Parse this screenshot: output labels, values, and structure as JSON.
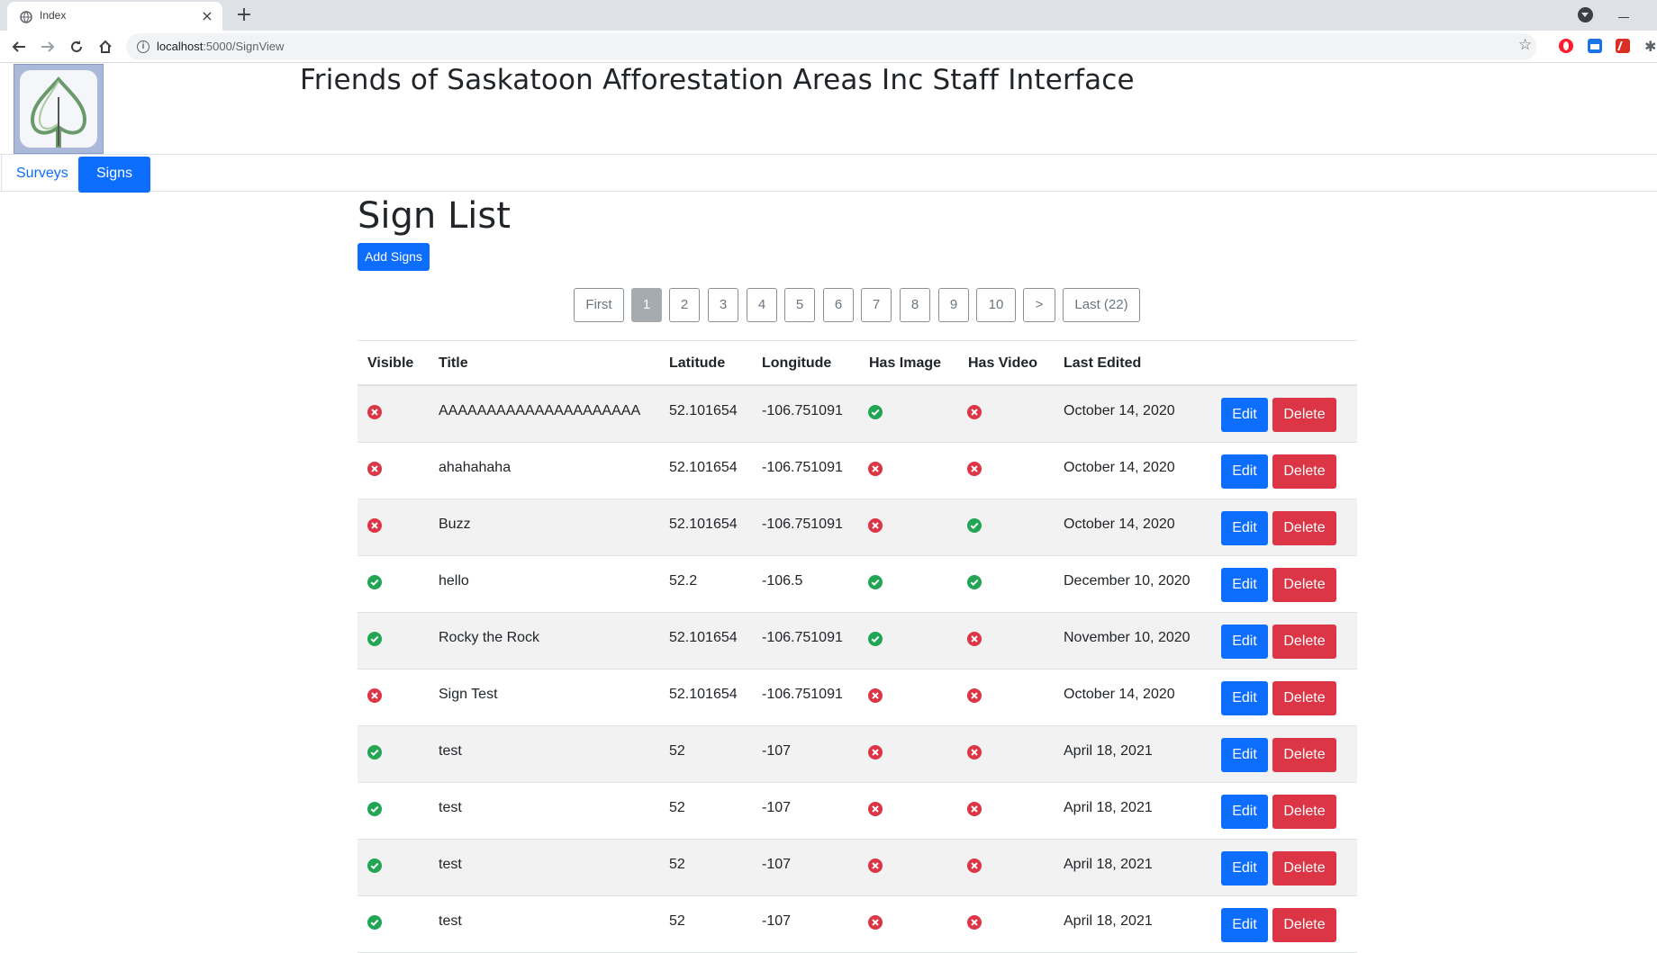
{
  "browser": {
    "tab_title": "Index",
    "url_host": "localhost",
    "url_path": ":5000/SignView"
  },
  "header": {
    "site_title": "Friends of Saskatoon Afforestation Areas Inc Staff Interface"
  },
  "nav": {
    "items": [
      {
        "label": "Surveys",
        "active": false
      },
      {
        "label": "Signs",
        "active": true
      }
    ]
  },
  "main": {
    "title": "Sign List",
    "add_button": "Add Signs",
    "pagination": {
      "items": [
        "First",
        "1",
        "2",
        "3",
        "4",
        "5",
        "6",
        "7",
        "8",
        "9",
        "10",
        ">",
        "Last (22)"
      ],
      "active": "1"
    },
    "table": {
      "columns": [
        "Visible",
        "Title",
        "Latitude",
        "Longitude",
        "Has Image",
        "Has Video",
        "Last Edited"
      ],
      "edit_label": "Edit",
      "delete_label": "Delete",
      "rows": [
        {
          "visible": false,
          "title": "AAAAAAAAAAAAAAAAAAAAA",
          "latitude": "52.101654",
          "longitude": "-106.751091",
          "has_image": true,
          "has_video": false,
          "last_edited": "October 14, 2020"
        },
        {
          "visible": false,
          "title": "ahahahaha",
          "latitude": "52.101654",
          "longitude": "-106.751091",
          "has_image": false,
          "has_video": false,
          "last_edited": "October 14, 2020"
        },
        {
          "visible": false,
          "title": "Buzz",
          "latitude": "52.101654",
          "longitude": "-106.751091",
          "has_image": false,
          "has_video": true,
          "last_edited": "October 14, 2020"
        },
        {
          "visible": true,
          "title": "hello",
          "latitude": "52.2",
          "longitude": "-106.5",
          "has_image": true,
          "has_video": true,
          "last_edited": "December 10, 2020"
        },
        {
          "visible": true,
          "title": "Rocky the Rock",
          "latitude": "52.101654",
          "longitude": "-106.751091",
          "has_image": true,
          "has_video": false,
          "last_edited": "November 10, 2020"
        },
        {
          "visible": false,
          "title": "Sign Test",
          "latitude": "52.101654",
          "longitude": "-106.751091",
          "has_image": false,
          "has_video": false,
          "last_edited": "October 14, 2020"
        },
        {
          "visible": true,
          "title": "test",
          "latitude": "52",
          "longitude": "-107",
          "has_image": false,
          "has_video": false,
          "last_edited": "April 18, 2021"
        },
        {
          "visible": true,
          "title": "test",
          "latitude": "52",
          "longitude": "-107",
          "has_image": false,
          "has_video": false,
          "last_edited": "April 18, 2021"
        },
        {
          "visible": true,
          "title": "test",
          "latitude": "52",
          "longitude": "-107",
          "has_image": false,
          "has_video": false,
          "last_edited": "April 18, 2021"
        },
        {
          "visible": true,
          "title": "test",
          "latitude": "52",
          "longitude": "-107",
          "has_image": false,
          "has_video": false,
          "last_edited": "April 18, 2021"
        }
      ]
    }
  },
  "colors": {
    "primary": "#0d6efd",
    "danger": "#dc3545",
    "success": "#22a554"
  }
}
